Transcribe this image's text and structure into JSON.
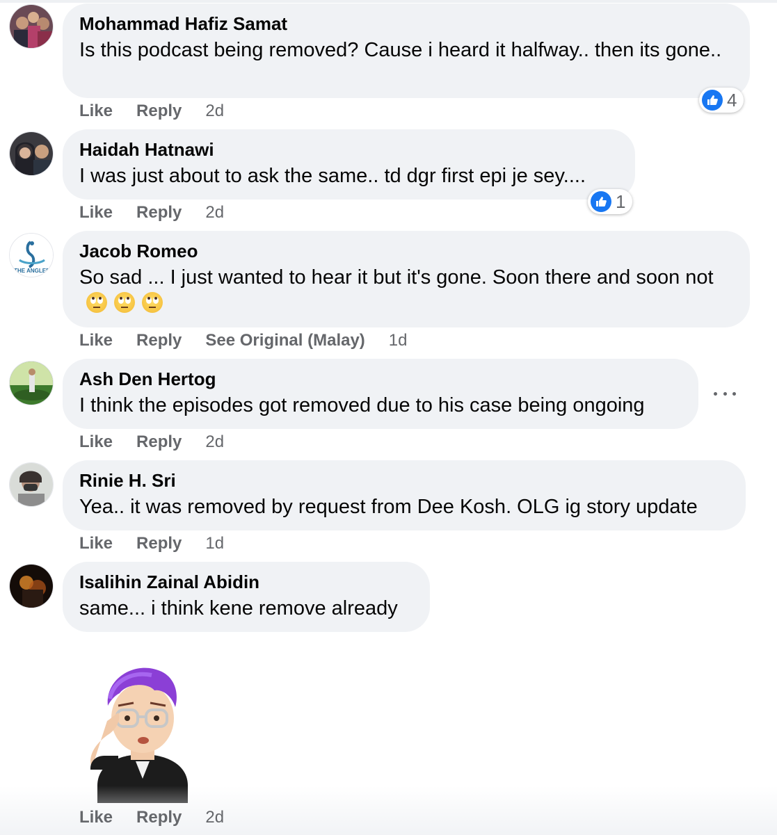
{
  "action_labels": {
    "like": "Like",
    "reply": "Reply"
  },
  "comments": [
    {
      "name": "Mohammad Hafiz Samat",
      "text": "Is this podcast being removed? Cause i heard it halfway.. then its gone..",
      "time": "2d",
      "reactions": "4"
    },
    {
      "name": "Haidah Hatnawi",
      "text": "I was just about to ask the same.. td dgr first epi je sey....",
      "time": "2d",
      "reactions": "1"
    },
    {
      "name": "Jacob Romeo",
      "text": "So sad ... I just wanted to hear it but it's gone. Soon there and soon not",
      "time": "1d",
      "see_original": "See Original (Malay)",
      "emojis": [
        "eye-roll-emoji",
        "eye-roll-emoji",
        "eye-roll-emoji"
      ]
    },
    {
      "name": "Ash Den Hertog",
      "text": "I think the episodes got removed due to his case being ongoing",
      "time": "2d"
    },
    {
      "name": "Rinie H. Sri",
      "text": "Yea.. it was removed by request from Dee Kosh. OLG ig story update",
      "time": "1d"
    },
    {
      "name": "Isalihin Zainal Abidin",
      "text": "same... i think kene remove already",
      "time": "2d"
    }
  ],
  "sticker_comment": {
    "time": "2d",
    "sticker": "thinking-avatar-sticker"
  },
  "avatar_logo_text": "THE ANGLER",
  "icons": {
    "like": "thumbs-up-icon",
    "more": "more-options-icon"
  },
  "colors": {
    "bubble": "#f0f2f5",
    "meta": "#65676b",
    "like_blue": "#1877f2"
  }
}
